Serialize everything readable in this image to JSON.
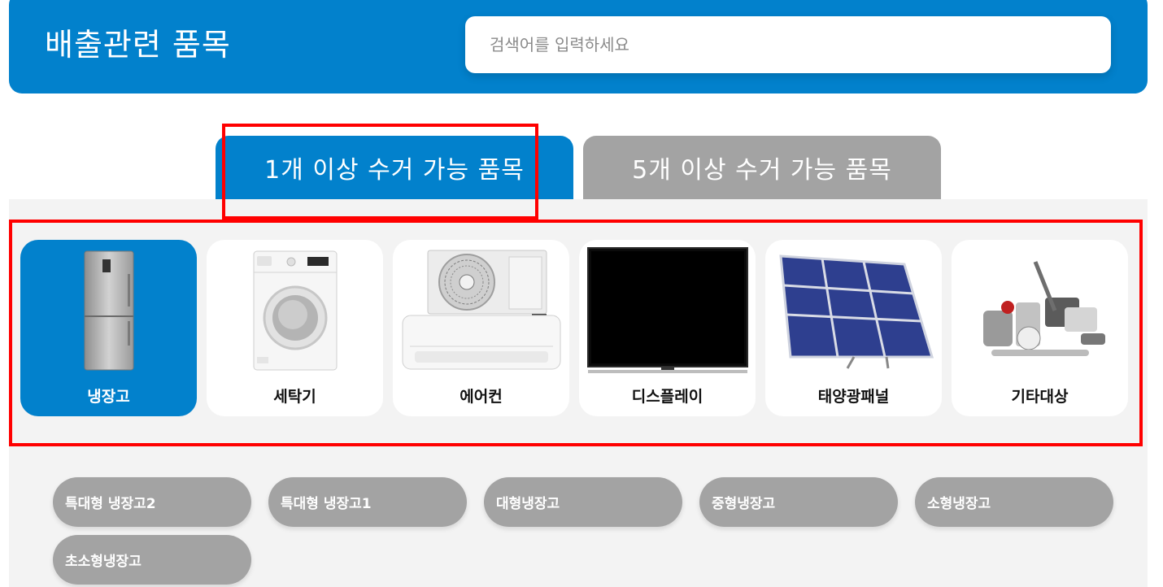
{
  "header": {
    "title": "배출관련 품목",
    "search_placeholder": "검색어를 입력하세요"
  },
  "tabs": [
    {
      "label": "1개 이상 수거 가능 품목",
      "active": true
    },
    {
      "label": "5개 이상 수거 가능 품목",
      "active": false
    }
  ],
  "categories": [
    {
      "label": "냉장고",
      "icon": "refrigerator-icon",
      "active": true
    },
    {
      "label": "세탁기",
      "icon": "washing-machine-icon",
      "active": false
    },
    {
      "label": "에어컨",
      "icon": "air-conditioner-icon",
      "active": false
    },
    {
      "label": "디스플레이",
      "icon": "display-icon",
      "active": false
    },
    {
      "label": "태양광패널",
      "icon": "solar-panel-icon",
      "active": false
    },
    {
      "label": "기타대상",
      "icon": "misc-appliances-icon",
      "active": false
    }
  ],
  "subcategories": [
    {
      "label": "특대형 냉장고2"
    },
    {
      "label": "특대형 냉장고1"
    },
    {
      "label": "대형냉장고"
    },
    {
      "label": "중형냉장고"
    },
    {
      "label": "소형냉장고"
    },
    {
      "label": "초소형냉장고"
    }
  ],
  "colors": {
    "primary": "#0281cc",
    "inactive": "#a3a3a3",
    "highlight": "#ff0000",
    "panel_bg": "#f3f3f3"
  }
}
